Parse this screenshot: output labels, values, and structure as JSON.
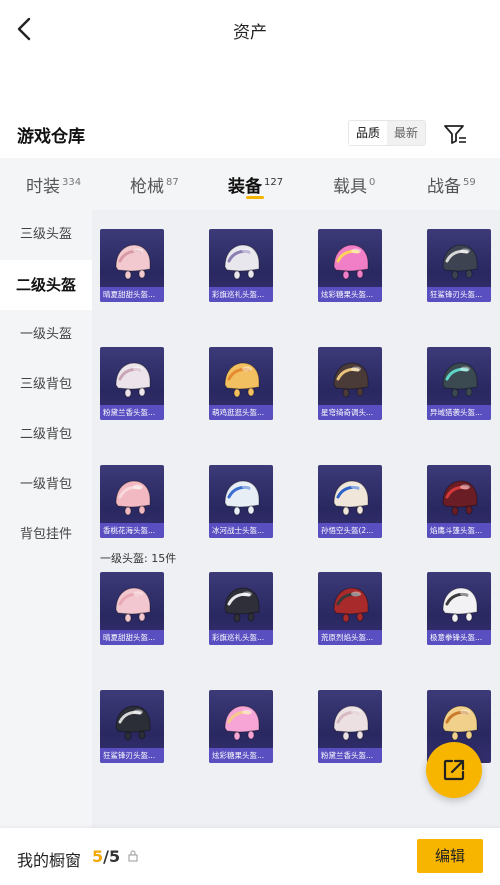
{
  "header": {
    "title": "资产"
  },
  "section": {
    "title": "游戏仓库",
    "sort_options": [
      "品质",
      "最新"
    ]
  },
  "tabs": [
    {
      "label": "时装",
      "count": "334"
    },
    {
      "label": "枪械",
      "count": "87"
    },
    {
      "label": "装备",
      "count": "127"
    },
    {
      "label": "载具",
      "count": "0"
    },
    {
      "label": "战备",
      "count": "59"
    }
  ],
  "sidebar": {
    "items": [
      "三级头盔",
      "二级头盔",
      "一级头盔",
      "三级背包",
      "二级背包",
      "一级背包",
      "背包挂件"
    ],
    "active_index": 1
  },
  "groups": {
    "level1_label": "一级头盔: 15件"
  },
  "items": [
    {
      "name": "晴夏甜甜头盔...",
      "color": "#f2c9cf",
      "accent": "#d89aa5"
    },
    {
      "name": "彩旗巡礼头盔...",
      "color": "#e9e7ee",
      "accent": "#8a7fb0"
    },
    {
      "name": "炫彩糖果头盔...",
      "color": "#f07fc8",
      "accent": "#ffd35a"
    },
    {
      "name": "狂鲨锋刃头盔...",
      "color": "#3d4350",
      "accent": "#d8d8d8"
    },
    {
      "name": "粉黛兰香头盔...",
      "color": "#ece4ea",
      "accent": "#c9a5b6"
    },
    {
      "name": "萌鸡逛逛头盔...",
      "color": "#f2c060",
      "accent": "#e58a2e"
    },
    {
      "name": "星穹绮奇调头...",
      "color": "#4a3a38",
      "accent": "#e8c27a"
    },
    {
      "name": "异域猎袭头盔...",
      "color": "#3b4a50",
      "accent": "#5fd6c8"
    },
    {
      "name": "香桃花海头盔...",
      "color": "#f3b9c2",
      "accent": "#f7d9dd"
    },
    {
      "name": "冰河战士头盔...",
      "color": "#e8eef6",
      "accent": "#3a6fd0"
    },
    {
      "name": "孙悟空头盔(2...",
      "color": "#f0e6da",
      "accent": "#2f63c9"
    },
    {
      "name": "焰鹰斗篷头盔...",
      "color": "#6a1d24",
      "accent": "#d43a3a"
    },
    {
      "name": "晴夏甜甜头盔...",
      "color": "#f3c7cf",
      "accent": "#e9a9b4"
    },
    {
      "name": "彩旗巡礼头盔...",
      "color": "#2e2f38",
      "accent": "#e8e8ec"
    },
    {
      "name": "荒原烈焰头盔...",
      "color": "#a82a2a",
      "accent": "#3a3a3a"
    },
    {
      "name": "极意拳锋头盔...",
      "color": "#f2f2f4",
      "accent": "#3a3a3a"
    },
    {
      "name": "狂鲨锋刃头盔...",
      "color": "#2b2e36",
      "accent": "#d6d6d6"
    },
    {
      "name": "炫彩糖果头盔...",
      "color": "#f6a5d6",
      "accent": "#f4c98a"
    },
    {
      "name": "粉黛兰香头盔...",
      "color": "#ece0e2",
      "accent": "#d6b9c1"
    },
    {
      "name": "",
      "color": "#f0d08a",
      "accent": "#c97a2a"
    }
  ],
  "bottom": {
    "showcase_label": "我的橱窗",
    "count_current": "5",
    "count_total": "/5",
    "edit_label": "编辑"
  },
  "colors": {
    "accent": "#f7b500",
    "card_bg": "#2e2b66",
    "card_caption": "#5a4fc0"
  }
}
